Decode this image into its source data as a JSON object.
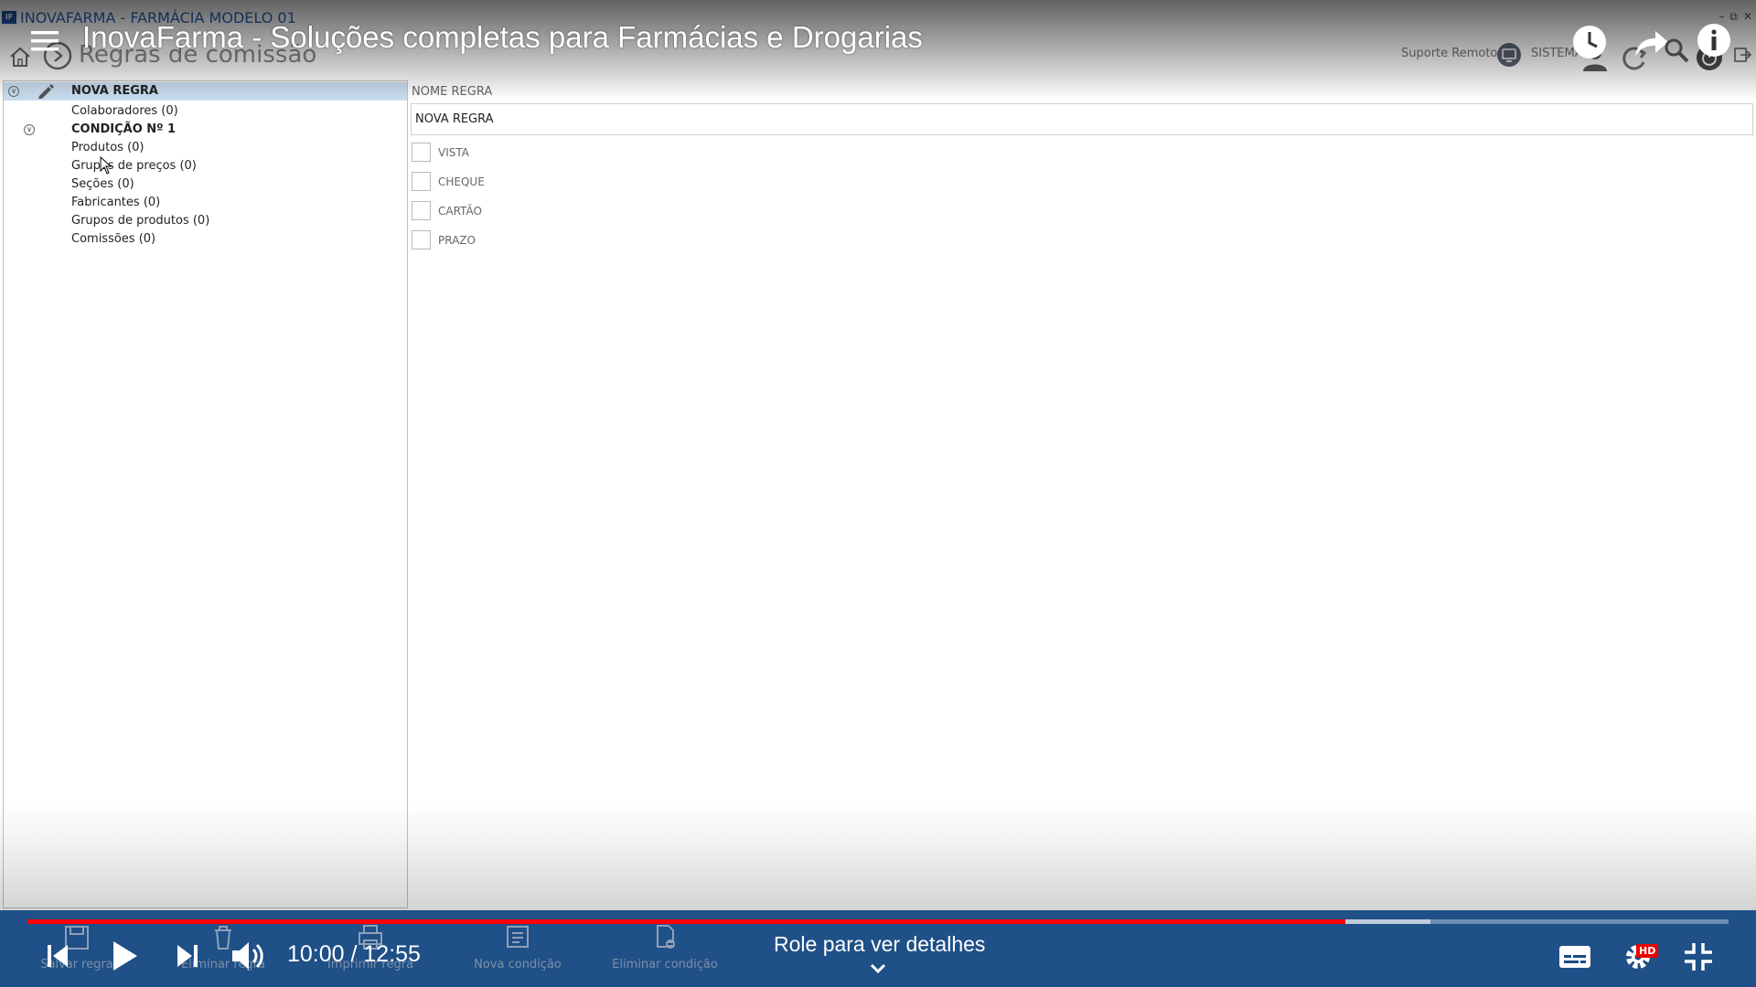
{
  "window": {
    "title": "INOVAFARMA - FARMÁCIA MODELO 01",
    "logo_text": "IF"
  },
  "header": {
    "page_title": "Regras de comissão",
    "remote_support": "Suporte Remoto",
    "system": "SISTEMA"
  },
  "tree": {
    "rule": "NOVA REGRA",
    "collaborators": "Colaboradores (0)",
    "condition": "CONDIÇÃO Nº 1",
    "items": [
      "Produtos (0)",
      "Grupos de preços (0)",
      "Seções (0)",
      "Fabricantes (0)",
      "Grupos de produtos (0)",
      "Comissões (0)"
    ]
  },
  "form": {
    "name_label": "NOME REGRA",
    "name_value": "NOVA REGRA",
    "payment_options": [
      {
        "label": "VISTA",
        "checked": false
      },
      {
        "label": "CHEQUE",
        "checked": false
      },
      {
        "label": "CARTÃO",
        "checked": false
      },
      {
        "label": "PRAZO",
        "checked": false
      }
    ]
  },
  "toolbar": {
    "save": "Salvar regra",
    "delete": "Eliminar regra",
    "print": "Imprimir regra",
    "new_condition": "Nova condição",
    "delete_condition": "Eliminar condição"
  },
  "player": {
    "video_title": "InovaFarma - Soluções completas para Farmácias e Drogarias",
    "current_time": "10:00",
    "duration": "12:55",
    "time_display": "10:00 / 12:55",
    "scroll_hint": "Role para ver detalhes",
    "quality_badge": "HD",
    "played_fraction": 0.7745,
    "buffered_fraction": 0.8245,
    "progress_color": "#ff0000",
    "band_color": "#184b84"
  }
}
